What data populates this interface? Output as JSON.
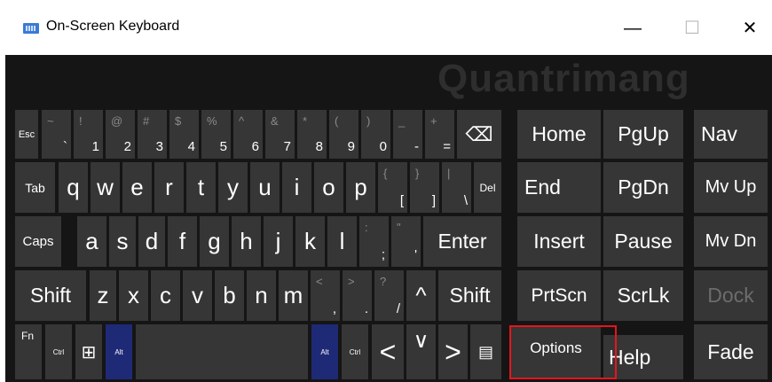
{
  "window": {
    "title": "On-Screen Keyboard",
    "icon": "keyboard-icon",
    "minimize": "—",
    "maximize": "☐",
    "close": "✕"
  },
  "watermark": "Quantrimang",
  "rows": {
    "r1": {
      "esc": "Esc",
      "tilde_up": "~",
      "tilde_lo": "`",
      "n1": {
        "up": "!",
        "lo": "1"
      },
      "n2": {
        "up": "@",
        "lo": "2"
      },
      "n3": {
        "up": "#",
        "lo": "3"
      },
      "n4": {
        "up": "$",
        "lo": "4"
      },
      "n5": {
        "up": "%",
        "lo": "5"
      },
      "n6": {
        "up": "^",
        "lo": "6"
      },
      "n7": {
        "up": "&",
        "lo": "7"
      },
      "n8": {
        "up": "*",
        "lo": "8"
      },
      "n9": {
        "up": "(",
        "lo": "9"
      },
      "n0": {
        "up": ")",
        "lo": "0"
      },
      "minus": {
        "up": "_",
        "lo": "-"
      },
      "equal": {
        "up": "+",
        "lo": "="
      },
      "backspace": "⌫"
    },
    "r2": {
      "tab": "Tab",
      "q": "q",
      "w": "w",
      "e": "e",
      "r": "r",
      "t": "t",
      "y": "y",
      "u": "u",
      "i": "i",
      "o": "o",
      "p": "p",
      "lbrace": {
        "up": "{",
        "lo": "["
      },
      "rbrace": {
        "up": "}",
        "lo": "]"
      },
      "pipe": {
        "up": "|",
        "lo": "\\"
      },
      "del": "Del"
    },
    "r3": {
      "caps": "Caps",
      "a": "a",
      "s": "s",
      "d": "d",
      "f": "f",
      "g": "g",
      "h": "h",
      "j": "j",
      "k": "k",
      "l": "l",
      "semi": {
        "up": ":",
        "lo": ";"
      },
      "quote": {
        "up": "\"",
        "lo": "'"
      },
      "enter": "Enter"
    },
    "r4": {
      "shift": "Shift",
      "z": "z",
      "x": "x",
      "c": "c",
      "v": "v",
      "b": "b",
      "n": "n",
      "m": "m",
      "comma": {
        "up": "<",
        "lo": ","
      },
      "period": {
        "up": ">",
        "lo": "."
      },
      "slash": {
        "up": "?",
        "lo": "/"
      },
      "up_arrow": "^",
      "shift_r": "Shift"
    },
    "r5": {
      "fn": "Fn",
      "ctrl": "Ctrl",
      "win": "⊞",
      "alt": "Alt",
      "alt_r": "Alt",
      "ctrl_r": "Ctrl",
      "left": "<",
      "down": "∨",
      "right": ">",
      "menu": "▤"
    }
  },
  "nav": {
    "home": "Home",
    "pgup": "PgUp",
    "nav": "Nav",
    "end": "End",
    "pgdn": "PgDn",
    "mvup": "Mv Up",
    "insert": "Insert",
    "pause": "Pause",
    "mvdn": "Mv Dn",
    "prtscn": "PrtScn",
    "scrlk": "ScrLk",
    "dock": "Dock",
    "options": "Options",
    "help": "Help",
    "fade": "Fade"
  },
  "colors": {
    "keyboard_bg": "#151515",
    "key_bg": "#363636",
    "modifier_active": "#1f2a77",
    "highlight": "#e8141c"
  }
}
